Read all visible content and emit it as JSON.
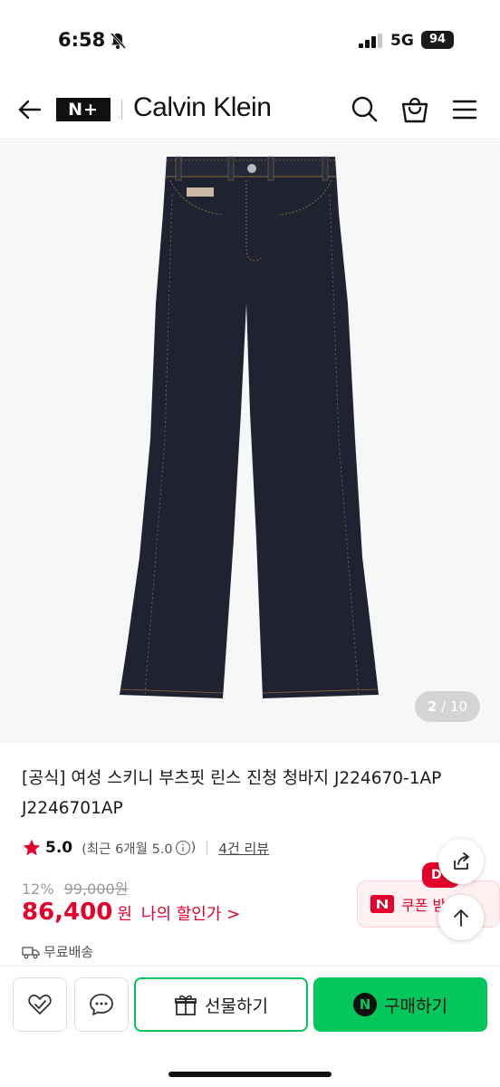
{
  "status_bar": {
    "time": "6:58",
    "network": "5G",
    "battery": "94"
  },
  "header": {
    "logo": "N+",
    "brand": "Calvin Klein"
  },
  "gallery": {
    "current": "2",
    "total": "/ 10"
  },
  "product": {
    "title": "[공식] 여성 스키니 부츠핏 린스 진청 청바지 J224670-1AP J2246701AP",
    "rating": "5.0",
    "rating_note": "(최근 6개월 5.0",
    "rating_note_end": ")",
    "review_link": "4건 리뷰",
    "discount_rate": "12%",
    "original_price": "99,000원",
    "sale_price": "86,400",
    "sale_unit": "원",
    "my_discount": "나의 할인가 >",
    "shipping": "무료배송"
  },
  "coupon": {
    "badge": "D",
    "label": "쿠폰 받"
  },
  "bottom_bar": {
    "gift_label": "선물하기",
    "buy_label": "구매하기",
    "buy_icon": "N"
  },
  "colors": {
    "naver_green": "#03c75a",
    "sale_red": "#e4002b",
    "denim": "#1f2230"
  },
  "icons": [
    "bell-off-icon",
    "signal-icon",
    "back-arrow-icon",
    "search-icon",
    "shopping-bag-icon",
    "menu-icon",
    "star-icon",
    "info-circle-icon",
    "truck-icon",
    "share-icon",
    "arrow-up-icon",
    "heart-check-icon",
    "chat-bubble-icon",
    "gift-icon"
  ]
}
